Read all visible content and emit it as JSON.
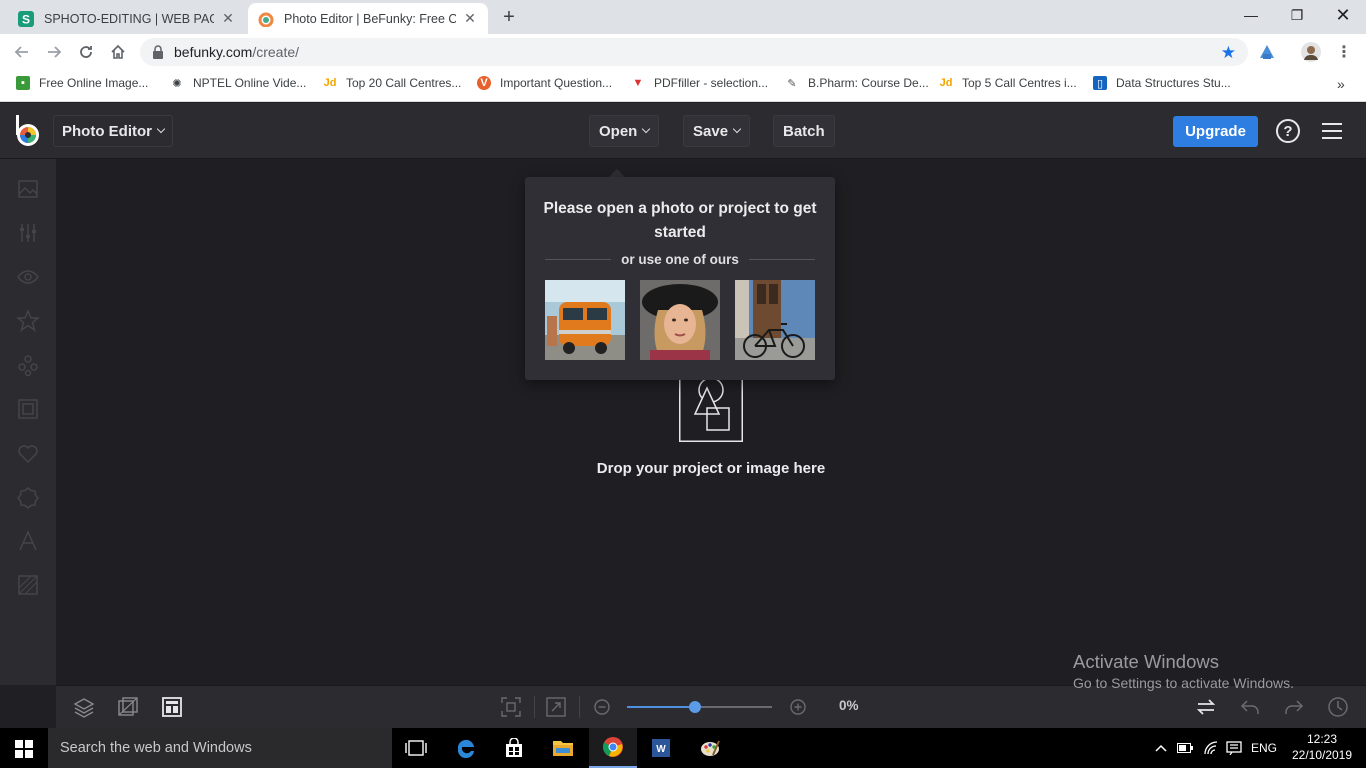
{
  "browser": {
    "tabs": [
      {
        "title": "SPHOTO-EDITING | WEB PAGE",
        "active": false
      },
      {
        "title": "Photo Editor | BeFunky: Free Onli",
        "active": true
      }
    ],
    "address": {
      "host": "befunky.com",
      "path": "/create/"
    },
    "bookmarks": [
      "Free Online Image...",
      "NPTEL Online Vide...",
      "Top 20 Call Centres...",
      "Important Question...",
      "PDFfiller - selection...",
      "B.Pharm: Course De...",
      "Top 5 Call Centres i...",
      "Data Structures Stu..."
    ],
    "bookmark_overflow": "»"
  },
  "app": {
    "editor_label": "Photo Editor",
    "open_label": "Open",
    "save_label": "Save",
    "batch_label": "Batch",
    "upgrade_label": "Upgrade",
    "help_label": "?",
    "popup": {
      "title": "Please open a photo or project to get started",
      "subtitle": "or use one of ours",
      "samples": [
        "orange-van-photo",
        "woman-hat-portrait-photo",
        "bicycle-door-photo"
      ]
    },
    "drop_text": "Drop your project or image here",
    "zoom": {
      "value_label": "0%",
      "level": 0.47
    },
    "accent_color": "#2d7ee0"
  },
  "watermark": {
    "line1": "Activate Windows",
    "line2": "Go to Settings to activate Windows."
  },
  "taskbar": {
    "search_placeholder": "Search the web and Windows",
    "language": "ENG",
    "time": "12:23",
    "date": "22/10/2019"
  }
}
